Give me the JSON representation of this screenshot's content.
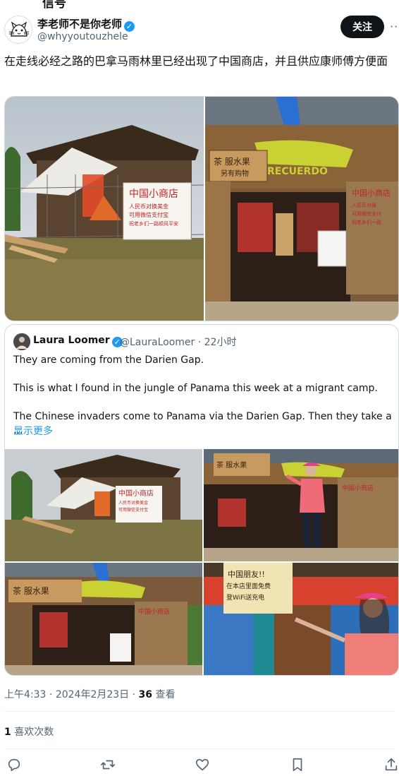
{
  "top_cut_text": "信号",
  "author": {
    "name": "李老师不是你老师",
    "handle": "@whyyoutouzhele"
  },
  "follow_label": "关注",
  "more_label": "···",
  "tweet_text": "在走线必经之路的巴拿马雨林里已经出现了中国商店，并且供应康师傅方便面",
  "photo_signs": {
    "sign1": "中国小商店\n人民币对换美金\n可用微信支付宝\n祝老乡们一路顺风平安",
    "sign2": "中国小商店\n人民币对换\n可用微信支付\n祝老乡们一路",
    "sign3": "茶 服水果\n另有购物",
    "sign4": "中国朋友!!\n在本店里面免费\n登WiFi送充电\n"
  },
  "quote": {
    "name": "Laura Loomer",
    "handle": "@LauraLoomer",
    "time": "22小时",
    "text": "They are coming from the Darien Gap.\n\nThis is what I found in the jungle of Panama this week at a migrant camp.\n\nThe Chinese invaders come to Panama via the Darien Gap. Then they take a ...",
    "show_more": "显示更多"
  },
  "timestamp": {
    "time": "上午4:33",
    "date": "2024年2月23日",
    "views_count": "36",
    "views_label": "查看"
  },
  "likes": {
    "count": "1",
    "label": "喜欢次数"
  },
  "icons": [
    "reply-icon",
    "retweet-icon",
    "like-icon",
    "bookmark-icon",
    "share-icon"
  ],
  "colors": {
    "accent": "#1d9bf0",
    "text": "#0f1419",
    "muted": "#536471",
    "border": "#cfd9de"
  }
}
